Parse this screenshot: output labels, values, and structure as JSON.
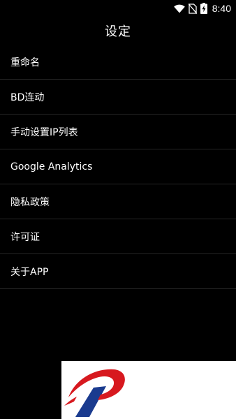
{
  "status_bar": {
    "time": "8:40",
    "icons": [
      "wifi-icon",
      "no-sim-icon",
      "battery-charging-icon"
    ]
  },
  "app_bar": {
    "title": "设定"
  },
  "settings": {
    "items": [
      {
        "label": "重命名"
      },
      {
        "label": "BD连动"
      },
      {
        "label": "手动设置IP列表"
      },
      {
        "label": "Google Analytics"
      },
      {
        "label": "隐私政策"
      },
      {
        "label": "许可证"
      },
      {
        "label": "关于APP"
      }
    ]
  },
  "watermark": {
    "icon": "brand-logo-icon",
    "colors": {
      "red": "#d7191f",
      "blue": "#1a3b8f",
      "background": "#ffffff"
    }
  }
}
